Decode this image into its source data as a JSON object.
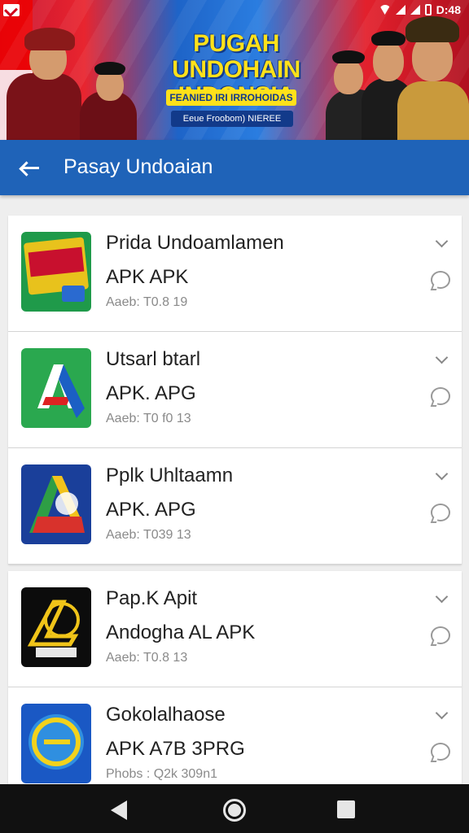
{
  "status_bar": {
    "time": "D:48"
  },
  "banner": {
    "title": "PUGAH UNDOHAIN INDONSIA",
    "subtitle": "FEANIED IRI IRROHOIDAS",
    "caption": "Eeue Froobom) NIEREE"
  },
  "appbar": {
    "title": "Pasay Undoaian"
  },
  "apps": [
    {
      "name": "Prida Undoamlamen",
      "sub": "APK APK",
      "meta": "Aaeb: T0.8 19"
    },
    {
      "name": "Utsarl btarl",
      "sub": "APK. APG",
      "meta": "Aaeb: T0 f0 13"
    },
    {
      "name": "Pplk Uhltaamn",
      "sub": "APK. APG",
      "meta": "Aaeb: T039 13"
    },
    {
      "name": "Pap.K Apit",
      "sub": "Andogha AL APK",
      "meta": "Aaeb: T0.8 13"
    },
    {
      "name": "Gokolalhaose",
      "sub": "APK A7B 3PRG",
      "meta": "Phobs : Q2k 309n1"
    }
  ],
  "colors": {
    "appbar": "#1f63b8",
    "banner_yellow": "#ffe11a"
  }
}
